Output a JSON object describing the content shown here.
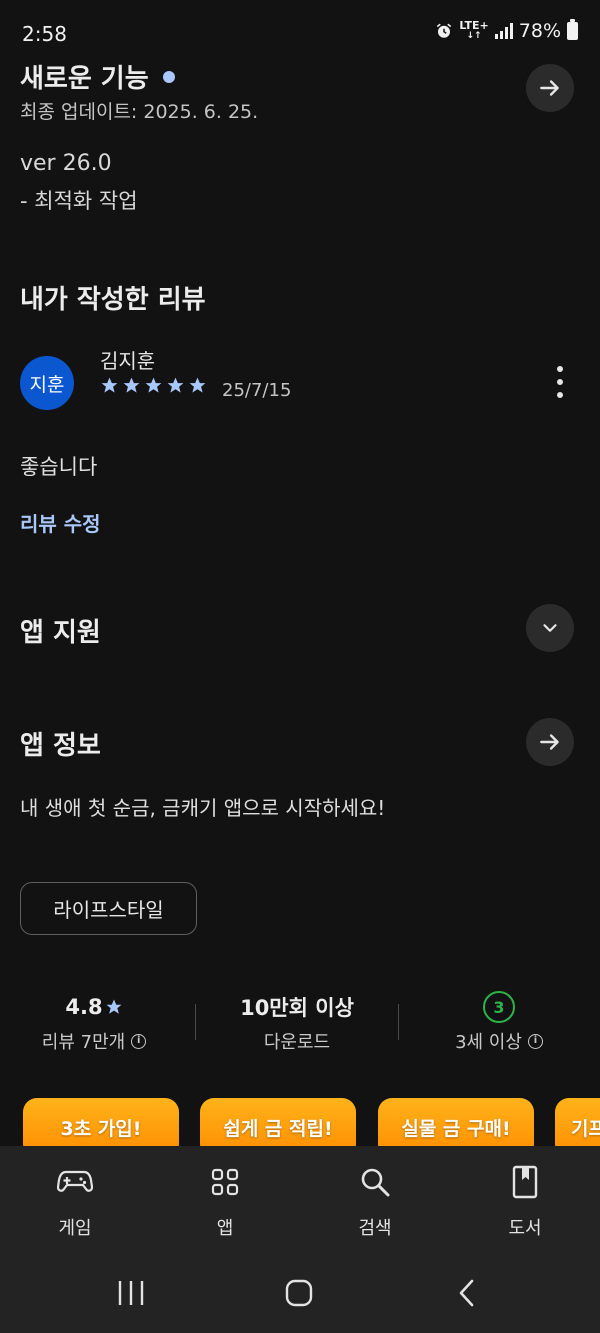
{
  "status": {
    "time": "2:58",
    "network": "LTE+",
    "battery": "78%"
  },
  "whats_new": {
    "title": "새로운 기능",
    "updated": "최종 업데이트: 2025. 6. 25.",
    "version": "ver 26.0",
    "notes": [
      "- 최적화 작업"
    ]
  },
  "my_review": {
    "heading": "내가 작성한 리뷰",
    "avatar_text": "지훈",
    "reviewer": "김지훈",
    "rating": 5,
    "date": "25/7/15",
    "text": "좋습니다",
    "edit_label": "리뷰 수정"
  },
  "app_support": {
    "heading": "앱 지원"
  },
  "app_info": {
    "heading": "앱 정보",
    "description": "내 생애 첫 순금, 금캐기 앱으로 시작하세요!",
    "category": "라이프스타일"
  },
  "stats": {
    "rating": "4.8",
    "reviews": "리뷰 7만개",
    "downloads": "10만회 이상",
    "downloads_label": "다운로드",
    "age_rating": "3",
    "age_label": "3세 이상"
  },
  "screenshots": [
    {
      "title": "3초 가입!"
    },
    {
      "title": "쉽게 금 적립!"
    },
    {
      "title": "실물 금 구매!"
    },
    {
      "title": "기프"
    }
  ],
  "bottom_nav": [
    {
      "label": "게임",
      "icon": "gamepad-icon"
    },
    {
      "label": "앱",
      "icon": "apps-grid-icon"
    },
    {
      "label": "검색",
      "icon": "search-icon"
    },
    {
      "label": "도서",
      "icon": "book-icon"
    }
  ],
  "colors": {
    "background": "#121212",
    "accent": "#a8c7fa",
    "avatar": "#0b57d0",
    "age_badge": "#2db24a",
    "screenshot": "#ff9f0a"
  }
}
